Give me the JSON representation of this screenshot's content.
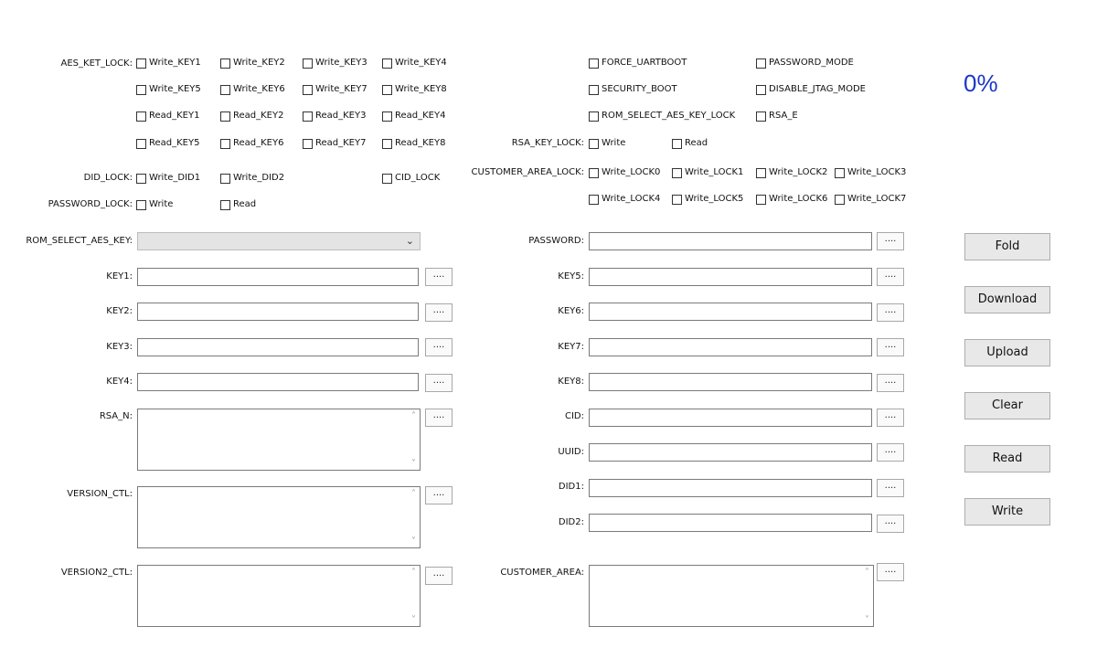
{
  "progress": {
    "value": "0%"
  },
  "locks_left": {
    "aes_ket_lock_label": "AES_KET_LOCK:",
    "aes_rows": [
      [
        "Write_KEY1",
        "Write_KEY2",
        "Write_KEY3",
        "Write_KEY4"
      ],
      [
        "Write_KEY5",
        "Write_KEY6",
        "Write_KEY7",
        "Write_KEY8"
      ],
      [
        "Read_KEY1",
        "Read_KEY2",
        "Read_KEY3",
        "Read_KEY4"
      ],
      [
        "Read_KEY5",
        "Read_KEY6",
        "Read_KEY7",
        "Read_KEY8"
      ]
    ],
    "did_lock_label": "DID_LOCK:",
    "did_items": [
      "Write_DID1",
      "Write_DID2"
    ],
    "cid_lock": "CID_LOCK",
    "password_lock_label": "PASSWORD_LOCK:",
    "password_items": [
      "Write",
      "Read"
    ]
  },
  "locks_right": {
    "modes": [
      "FORCE_UARTBOOT",
      "PASSWORD_MODE",
      "SECURITY_BOOT",
      "DISABLE_JTAG_MODE",
      "ROM_SELECT_AES_KEY_LOCK",
      "RSA_E"
    ],
    "rsa_key_lock_label": "RSA_KEY_LOCK:",
    "rsa_items": [
      "Write",
      "Read"
    ],
    "customer_area_lock_label": "CUSTOMER_AREA_LOCK:",
    "customer_rows": [
      [
        "Write_LOCK0",
        "Write_LOCK1",
        "Write_LOCK2",
        "Write_LOCK3"
      ],
      [
        "Write_LOCK4",
        "Write_LOCK5",
        "Write_LOCK6",
        "Write_LOCK7"
      ]
    ]
  },
  "fields_left": {
    "rom_select_label": "ROM_SELECT_AES_KEY:",
    "rom_select_value": "",
    "key_labels": [
      "KEY1:",
      "KEY2:",
      "KEY3:",
      "KEY4:"
    ],
    "rsa_n_label": "RSA_N:",
    "version_ctl_label": "VERSION_CTL:",
    "version2_ctl_label": "VERSION2_CTL:"
  },
  "fields_right": {
    "password_label": "PASSWORD:",
    "key_labels": [
      "KEY5:",
      "KEY6:",
      "KEY7:",
      "KEY8:"
    ],
    "cid_label": "CID:",
    "uuid_label": "UUID:",
    "did1_label": "DID1:",
    "did2_label": "DID2:",
    "customer_area_label": "CUSTOMER_AREA:"
  },
  "browse_label": "....",
  "buttons": {
    "fold": "Fold",
    "download": "Download",
    "upload": "Upload",
    "clear": "Clear",
    "read": "Read",
    "write": "Write"
  }
}
